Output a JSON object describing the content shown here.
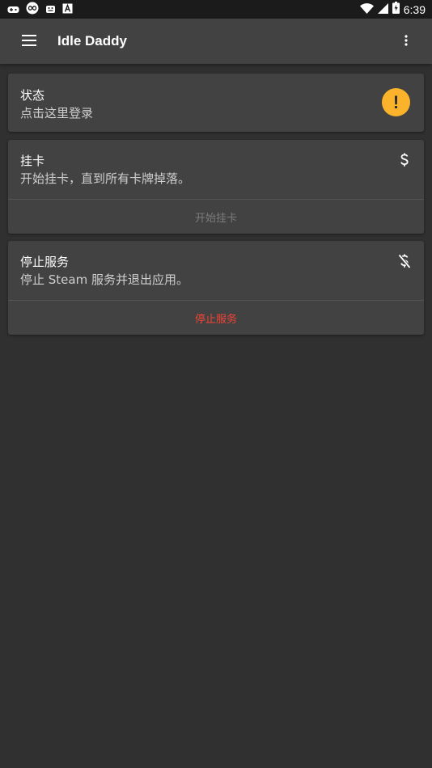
{
  "status_bar": {
    "time": "6:39"
  },
  "app_bar": {
    "title": "Idle Daddy"
  },
  "cards": {
    "status": {
      "title": "状态",
      "text": "点击这里登录",
      "icon": "warning-icon",
      "icon_color": "#fbb32c"
    },
    "idle": {
      "title": "挂卡",
      "text": "开始挂卡，直到所有卡牌掉落。",
      "icon": "dollar-icon",
      "action_label": "开始挂卡"
    },
    "stop": {
      "title": "停止服务",
      "text": "停止 Steam 服务并退出应用。",
      "icon": "dollar-off-icon",
      "action_label": "停止服务",
      "action_color": "#f44336"
    }
  }
}
